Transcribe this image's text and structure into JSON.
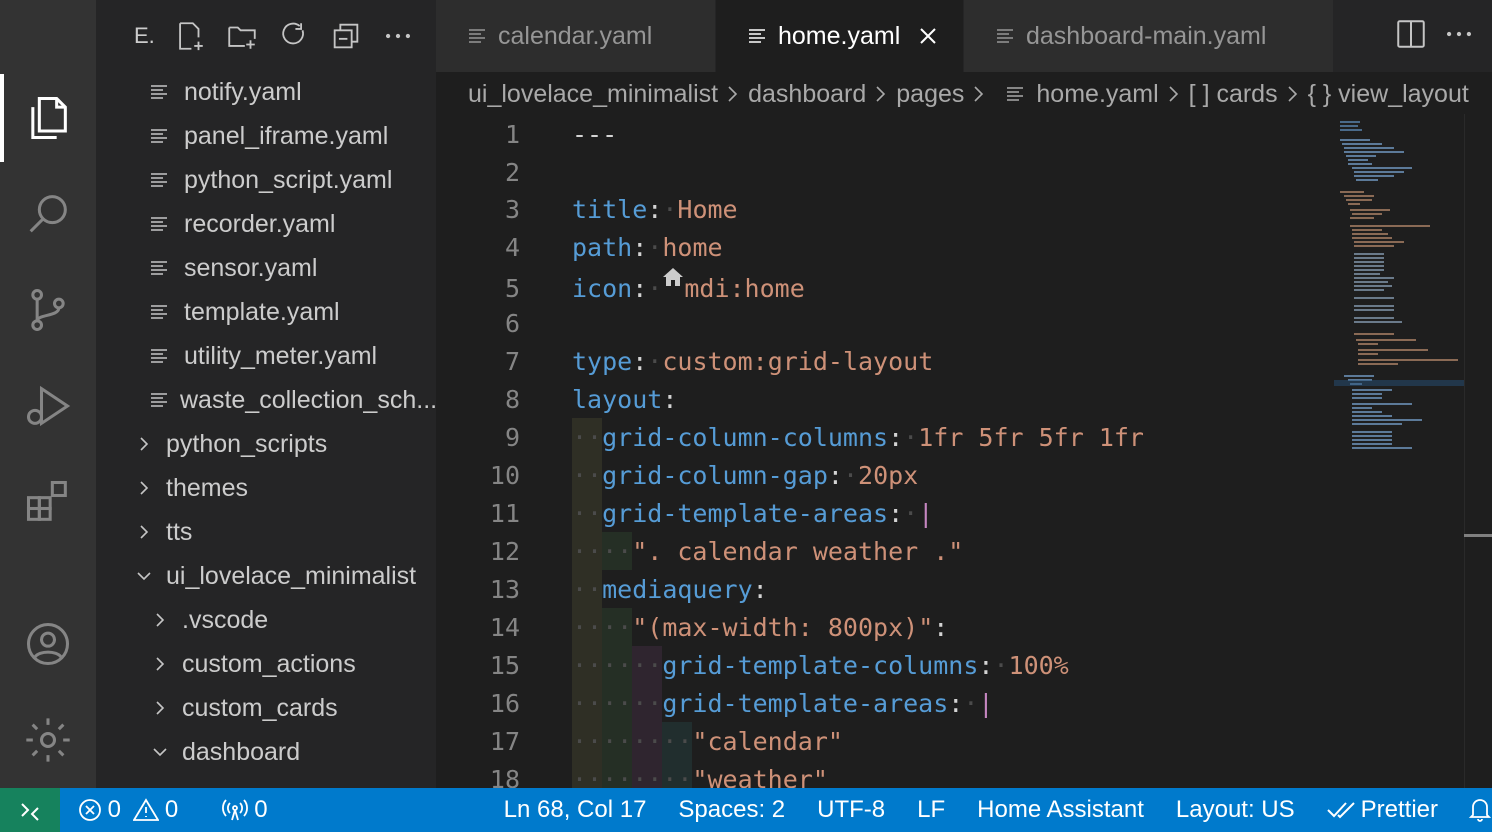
{
  "sidebar": {
    "title": "E.",
    "files": [
      {
        "label": "notify.yaml"
      },
      {
        "label": "panel_iframe.yaml"
      },
      {
        "label": "python_script.yaml"
      },
      {
        "label": "recorder.yaml"
      },
      {
        "label": "sensor.yaml"
      },
      {
        "label": "template.yaml"
      },
      {
        "label": "utility_meter.yaml"
      },
      {
        "label": "waste_collection_sch..."
      }
    ],
    "folders": [
      {
        "label": "python_scripts"
      },
      {
        "label": "themes"
      },
      {
        "label": "tts"
      },
      {
        "label": "ui_lovelace_minimalist"
      },
      {
        "label": ".vscode"
      },
      {
        "label": "custom_actions"
      },
      {
        "label": "custom_cards"
      },
      {
        "label": "dashboard"
      }
    ]
  },
  "tabs": [
    {
      "label": "calendar.yaml"
    },
    {
      "label": "home.yaml"
    },
    {
      "label": "dashboard-main.yaml"
    }
  ],
  "breadcrumbs": [
    "ui_lovelace_minimalist",
    "dashboard",
    "pages",
    "home.yaml",
    "[ ] cards",
    "{ } view_layout"
  ],
  "editor": {
    "line_numbers": [
      "1",
      "2",
      "3",
      "4",
      "5",
      "6",
      "7",
      "8",
      "9",
      "10",
      "11",
      "12",
      "13",
      "14",
      "15",
      "16",
      "17",
      "18"
    ],
    "l1": "---",
    "l3_key": "title",
    "l3_val": "Home",
    "l4_key": "path",
    "l4_val": "home",
    "l5_key": "icon",
    "l5_val": "mdi:home",
    "l7_key": "type",
    "l7_val": "custom:grid-layout",
    "l8_key": "layout",
    "l9_key": "grid-column-columns",
    "l9_val": "1fr 5fr 5fr 1fr",
    "l10_key": "grid-column-gap",
    "l10_val": "20px",
    "l11_key": "grid-template-areas",
    "l11_val": "|",
    "l12_val": "\". calendar weather .\"",
    "l13_key": "mediaquery",
    "l14_key": "\"(max-width: 800px)\"",
    "l15_key": "grid-template-columns",
    "l15_val": "100%",
    "l16_key": "grid-template-areas",
    "l16_val": "|",
    "l17_val": "\"calendar\"",
    "l18_val": "\"weather\""
  },
  "status": {
    "errors": "0",
    "warnings": "0",
    "ports": "0",
    "position": "Ln 68, Col 17",
    "spaces": "Spaces: 2",
    "encoding": "UTF-8",
    "eol": "LF",
    "language": "Home Assistant",
    "layout": "Layout: US",
    "formatter": "Prettier"
  },
  "colors": {
    "accent": "#007acc",
    "remote": "#16825d",
    "key": "#569cd6",
    "string": "#ce9178"
  }
}
